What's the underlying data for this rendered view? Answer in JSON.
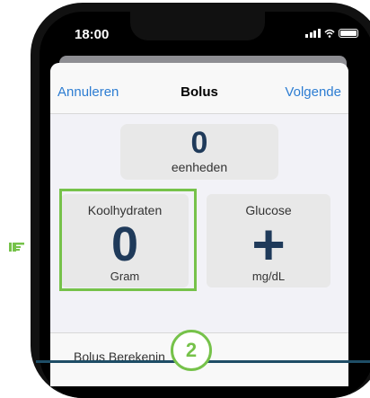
{
  "status_bar": {
    "time": "18:00"
  },
  "nav": {
    "cancel_label": "Annuleren",
    "title": "Bolus",
    "next_label": "Volgende"
  },
  "units": {
    "value": "0",
    "label": "eenheden"
  },
  "carbs": {
    "label": "Koolhydraten",
    "value": "0",
    "unit": "Gram"
  },
  "glucose": {
    "label": "Glucose",
    "value": "+",
    "unit": "mg/dL"
  },
  "section": {
    "label": "Bolus Berekenin"
  },
  "step_badge": {
    "number": "2"
  },
  "colors": {
    "accent_blue": "#2d7dd2",
    "highlight_green": "#76c24a",
    "value_navy": "#1f3a5a",
    "rule_blue": "#1e4d66"
  },
  "icons": [
    "pointing-hand-icon",
    "signal-icon",
    "wifi-icon",
    "battery-icon"
  ]
}
